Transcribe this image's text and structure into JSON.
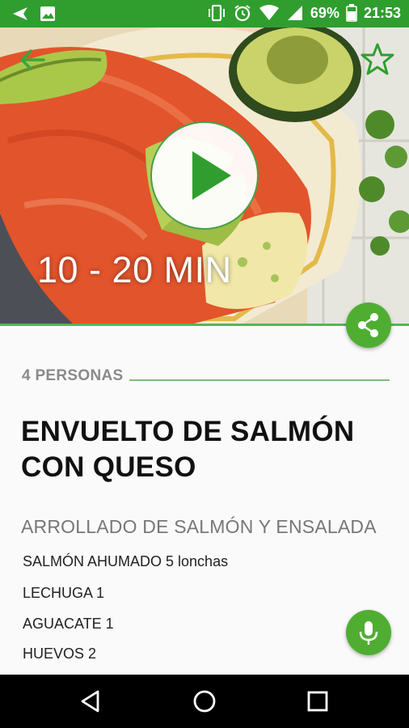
{
  "status_bar": {
    "battery_percent": "69%",
    "time": "21:53",
    "icons": [
      "send-icon",
      "image-icon",
      "vibrate-icon",
      "alarm-icon",
      "wifi-icon",
      "signal-icon",
      "battery-icon"
    ]
  },
  "recipe": {
    "time": "10 - 20 MIN",
    "servings": "4 PERSONAS",
    "title": "ENVUELTO DE SALMÓN CON QUESO",
    "subtitle": "ARROLLADO DE SALMÓN Y ENSALADA",
    "ingredients": [
      {
        "name": "SALMÓN AHUMADO 5 lonchas"
      },
      {
        "name": "LECHUGA 1"
      },
      {
        "name": "AGUACATE 1"
      },
      {
        "name": "HUEVOS 2"
      }
    ]
  },
  "colors": {
    "accent": "#2f9e2f",
    "fab": "#4fae32",
    "divider": "#7bbd7b"
  },
  "icons": {
    "back": "back-arrow-icon",
    "favorite": "star-outline-icon",
    "play": "play-icon",
    "share": "share-icon",
    "voice": "microphone-icon"
  }
}
